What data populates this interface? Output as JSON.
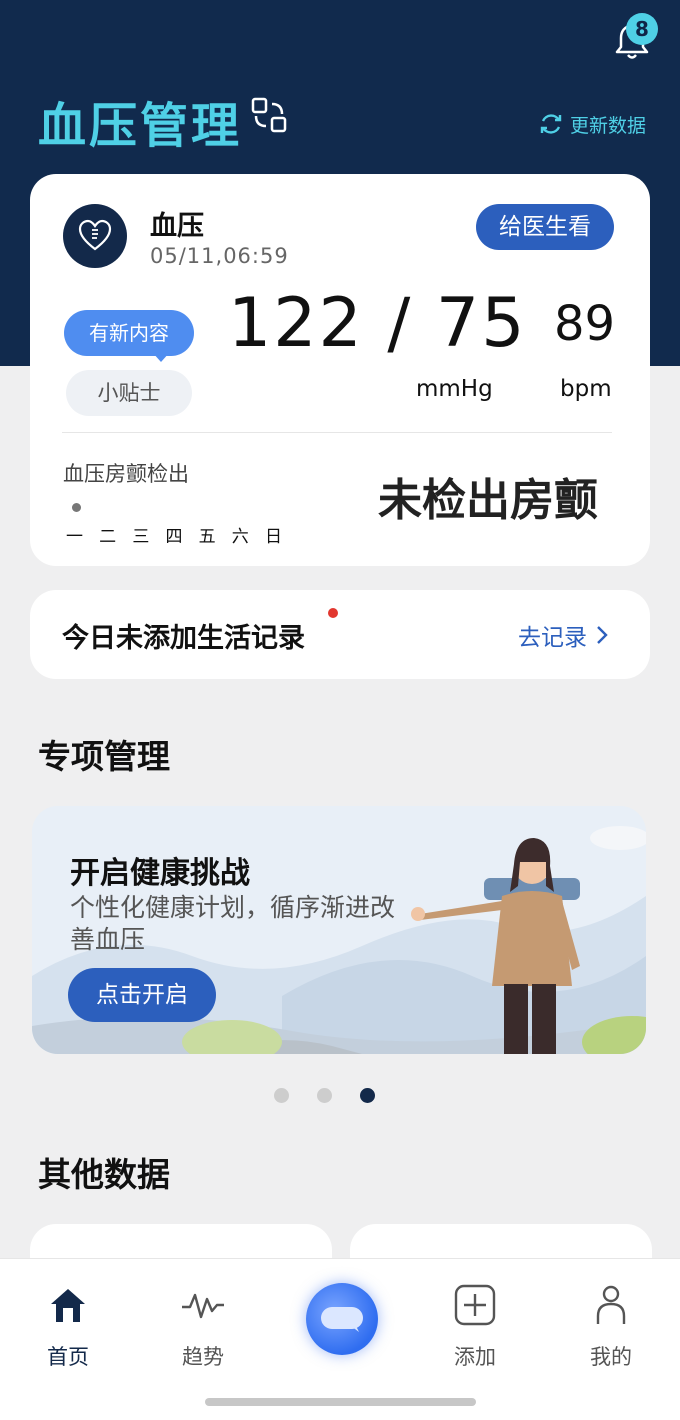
{
  "header": {
    "title": "血压管理",
    "refresh_label": "更新数据",
    "notification_count": "8"
  },
  "bp_card": {
    "label": "血压",
    "timestamp": "05/11,06:59",
    "doctor_button": "给医生看",
    "new_content_badge": "有新内容",
    "tips_button": "小贴士",
    "reading": "122 / 75",
    "reading_unit": "mmHg",
    "pulse": "89",
    "pulse_unit": "bpm",
    "af_title": "血压房颤检出",
    "af_result": "未检出房颤",
    "weekdays": [
      "一",
      "二",
      "三",
      "四",
      "五",
      "六",
      "日"
    ]
  },
  "log_card": {
    "text": "今日未添加生活记录",
    "link": "去记录"
  },
  "special": {
    "title": "专项管理",
    "banner_title": "开启健康挑战",
    "banner_subtitle": "个性化健康计划，循序渐进改善血压",
    "banner_button": "点击开启",
    "carousel_active_index": 2
  },
  "other": {
    "title": "其他数据"
  },
  "tabbar": {
    "home": "首页",
    "trend": "趋势",
    "add": "添加",
    "me": "我的"
  },
  "colors": {
    "header_bg": "#112a4d",
    "accent_cyan": "#4fd0e6",
    "primary_blue": "#2c5fbd"
  }
}
